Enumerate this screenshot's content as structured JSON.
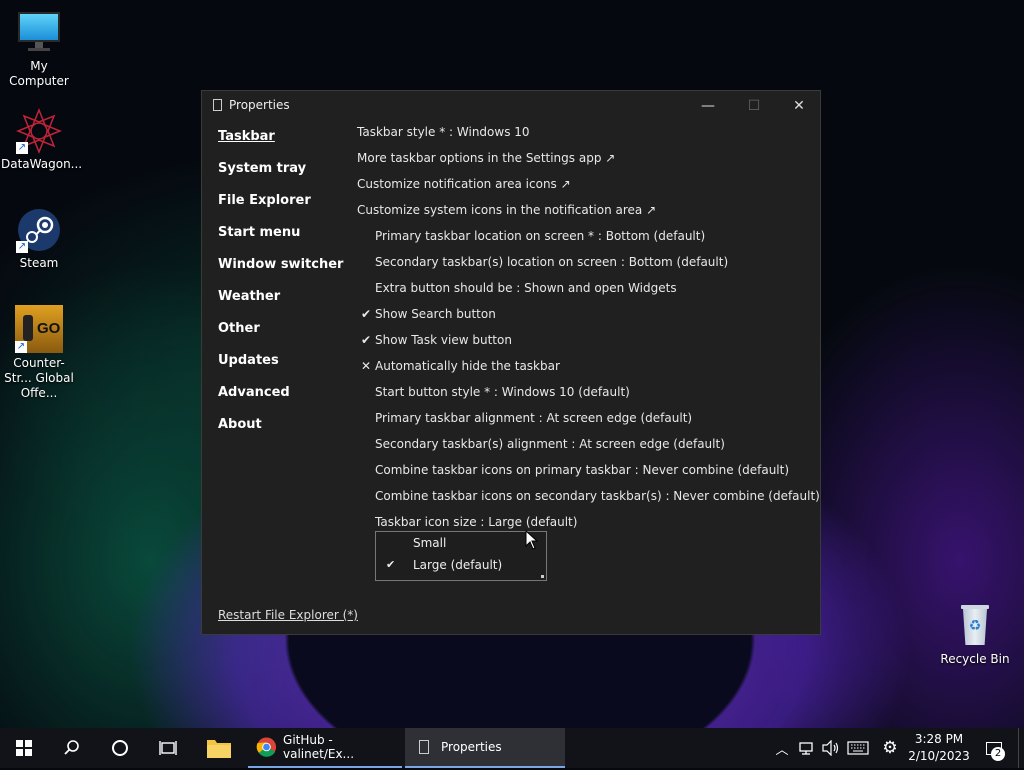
{
  "desktop": {
    "icons": [
      {
        "label": "My Computer"
      },
      {
        "label": "DataWagon..."
      },
      {
        "label": "Steam"
      },
      {
        "label": "Counter-Str... Global Offe..."
      },
      {
        "label": "Recycle Bin"
      }
    ]
  },
  "window": {
    "title": "Properties",
    "controls": {
      "minimize": "—",
      "maximize": "☐",
      "close": "✕"
    },
    "nav": [
      "Taskbar",
      "System tray",
      "File Explorer",
      "Start menu",
      "Window switcher",
      "Weather",
      "Other",
      "Updates",
      "Advanced",
      "About"
    ],
    "rows": [
      {
        "text": "Taskbar style * : Windows 10",
        "mark": ""
      },
      {
        "text": "More taskbar options in the Settings app ↗",
        "mark": ""
      },
      {
        "text": "Customize notification area icons ↗",
        "mark": ""
      },
      {
        "text": "Customize system icons in the notification area ↗",
        "mark": ""
      },
      {
        "text": "Primary taskbar location on screen * : Bottom (default)",
        "mark": ""
      },
      {
        "text": "Secondary taskbar(s) location on screen : Bottom (default)",
        "mark": ""
      },
      {
        "text": "Extra button should be : Shown and open Widgets",
        "mark": ""
      },
      {
        "text": "Show Search button",
        "mark": "✔"
      },
      {
        "text": "Show Task view button",
        "mark": "✔"
      },
      {
        "text": "Automatically hide the taskbar",
        "mark": "✕"
      },
      {
        "text": "Start button style * : Windows 10 (default)",
        "mark": ""
      },
      {
        "text": "Primary taskbar alignment : At screen edge (default)",
        "mark": ""
      },
      {
        "text": "Secondary taskbar(s) alignment : At screen edge (default)",
        "mark": ""
      },
      {
        "text": "Combine taskbar icons on primary taskbar : Never combine (default)",
        "mark": ""
      },
      {
        "text": "Combine taskbar icons on secondary taskbar(s) : Never combine (default)",
        "mark": ""
      },
      {
        "text": "Taskbar icon size : Large (default)",
        "mark": ""
      }
    ],
    "dropdown": {
      "options": [
        {
          "label": "Small",
          "check": ""
        },
        {
          "label": "Large (default)",
          "check": "✔"
        }
      ]
    },
    "restart_link": "Restart File Explorer (*)"
  },
  "taskbar": {
    "apps": [
      {
        "label": "GitHub - valinet/Ex..."
      },
      {
        "label": "Properties"
      }
    ],
    "clock": {
      "time": "3:28 PM",
      "date": "2/10/2023"
    },
    "notification_count": "2"
  },
  "colors": {
    "window_bg": "#202020",
    "taskbar_bg": "#111318",
    "active_app_bg": "#2e3036"
  }
}
